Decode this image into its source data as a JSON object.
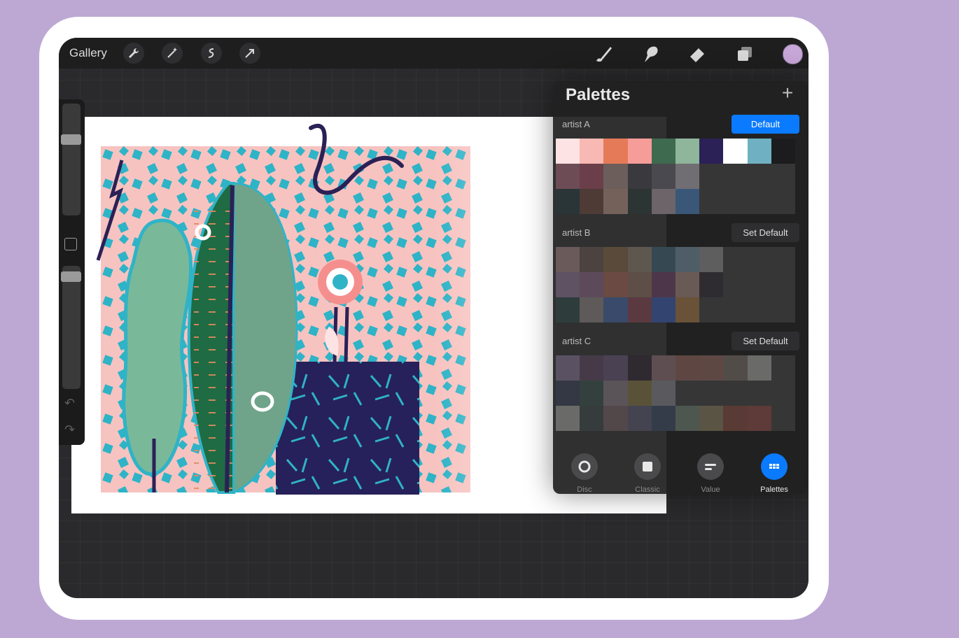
{
  "toolbar": {
    "gallery_label": "Gallery",
    "actions": [
      {
        "icon": "wrench-icon"
      },
      {
        "icon": "magic-wand-icon"
      },
      {
        "icon": "selection-icon"
      },
      {
        "icon": "transform-arrow-icon"
      }
    ],
    "tools": [
      {
        "icon": "brush-icon"
      },
      {
        "icon": "smudge-icon"
      },
      {
        "icon": "eraser-icon"
      },
      {
        "icon": "layers-icon"
      }
    ],
    "current_color": "#c7a6d8"
  },
  "sidebar": {
    "brush_size_level": 0.7,
    "opacity_level": 0.95
  },
  "palettes_panel": {
    "title": "Palettes",
    "add_label": "+",
    "palettes": [
      {
        "name": "artist A",
        "default_label": "Default",
        "is_default": true,
        "rows": [
          [
            "#fde3e3",
            "#f8b8b3",
            "#e57a58",
            "#f69d9a",
            "#3e6a4f",
            "#8fb59b",
            "#2b2156",
            "#ffffff",
            "#6fb1c2",
            "#1c1c1e"
          ],
          [
            "#6e4c55",
            "#6a3f4a",
            "#6b5e5b",
            "#3a393d",
            "#4a4950",
            "#706e73",
            "#363637",
            "#363637",
            "#363637",
            "#363637"
          ],
          [
            "#2a3538",
            "#4e3b35",
            "#74625a",
            "#2c3434",
            "#6c6468",
            "#3a5778",
            "#363637",
            "#363637",
            "#363637",
            "#363637"
          ]
        ]
      },
      {
        "name": "artist B",
        "default_label": "Set Default",
        "is_default": false,
        "rows": [
          [
            "#6b5a5a",
            "#4c423f",
            "#5a4a3a",
            "#5d5750",
            "#364952",
            "#4f5e66",
            "#5e5e5e",
            "#363637",
            "#363637",
            "#363637"
          ],
          [
            "#5e5263",
            "#5c4a5a",
            "#6a4a42",
            "#5e4e48",
            "#4e364a",
            "#6a5a55",
            "#2e2c30",
            "#363637",
            "#363637",
            "#363637"
          ],
          [
            "#2e3c3c",
            "#5e5a5a",
            "#3a4a6a",
            "#5a3a40",
            "#334470",
            "#6a5238",
            "#363637",
            "#363637",
            "#363637",
            "#363637"
          ]
        ]
      },
      {
        "name": "artist C",
        "default_label": "Set Default",
        "is_default": false,
        "rows": [
          [
            "#5a5262",
            "#463a48",
            "#4a4252",
            "#2e2a30",
            "#5e4e52",
            "#5e4642",
            "#5e4844",
            "#524c48",
            "#6a6a68",
            "#363637"
          ],
          [
            "#343844",
            "#34403e",
            "#5a5458",
            "#5a5238",
            "#5a5a5e",
            "#363637",
            "#363637",
            "#363637",
            "#363637",
            "#363637"
          ],
          [
            "#6a6a68",
            "#363c3c",
            "#52484a",
            "#444450",
            "#343c4a",
            "#4e5650",
            "#5a5444",
            "#5a3a34",
            "#5e3a38",
            "#363637"
          ]
        ]
      }
    ],
    "tabs": [
      {
        "label": "Disc",
        "icon": "disc-icon",
        "active": false
      },
      {
        "label": "Classic",
        "icon": "classic-square-icon",
        "active": false
      },
      {
        "label": "Value",
        "icon": "value-sliders-icon",
        "active": false
      },
      {
        "label": "Palettes",
        "icon": "palettes-grid-icon",
        "active": true
      }
    ]
  },
  "accent_color": "#0a7aff",
  "background_color": "#bda8d4"
}
